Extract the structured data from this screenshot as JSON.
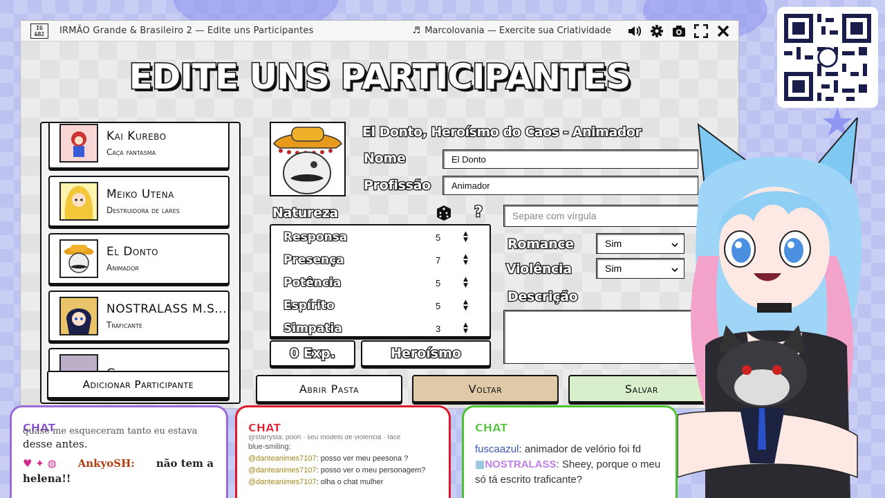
{
  "window": {
    "logo_top": "IG",
    "logo_bottom": "&B2",
    "title": "IRMÃO Grande & Brasileiro 2 — Edite uns Participantes",
    "music_icon": "♬",
    "music": "Marcolovania — Exercite sua Criatividade",
    "icons": [
      "volume-icon",
      "gear-icon",
      "camera-icon",
      "fullscreen-icon",
      "close-icon"
    ]
  },
  "page_title": "EDITE UNS PARTICIPANTES",
  "participants": [
    {
      "name": "Kai Kurebo",
      "role": "Caça fantasma"
    },
    {
      "name": "Meiko Utena",
      "role": "Destruidora de lares"
    },
    {
      "name": "El Donto",
      "role": "Animador"
    },
    {
      "name": "NOSTRALASS M.S...",
      "role": "Traficante"
    },
    {
      "name": "Guaxinico",
      "role": ""
    }
  ],
  "add_participant": "Adicionar Participante",
  "editor": {
    "heading": "El Donto, Heroísmo do Caos - Animador",
    "name_label": "Nome",
    "name_value": "El Donto",
    "profession_label": "Profissão",
    "profession_value": "Animador",
    "nature_label": "Natureza",
    "dice_icon": "dice-icon",
    "help": "?",
    "tags_placeholder": "Separe com vírgula",
    "stats": [
      {
        "name": "Responsa",
        "value": "5"
      },
      {
        "name": "Presença",
        "value": "7"
      },
      {
        "name": "Potência",
        "value": "5"
      },
      {
        "name": "Espírito",
        "value": "5"
      },
      {
        "name": "Simpatia",
        "value": "3"
      }
    ],
    "romance_label": "Romance",
    "romance_value": "Sim",
    "violence_label": "Violência",
    "violence_value": "Sim",
    "description_label": "Descrição",
    "exp": "0 Exp.",
    "trait": "Heroísmo",
    "open_folder": "Abrir Pasta",
    "back": "Voltar",
    "save": "Salvar"
  },
  "chats": {
    "left": {
      "title": "CHAT",
      "color": "#7b3fd0",
      "top_fragment": "quase me esqueceram tanto eu estava",
      "line1": "desse antes.",
      "user": "AnkyoSH:",
      "msg": "não tem a",
      "msg2": "helena!!"
    },
    "middle": {
      "title": "CHAT",
      "color": "#e0182a",
      "top_fragment": "@starrysta: pooh · seu modelo de violência · face",
      "line0": "blue-smiling:",
      "messages": [
        {
          "user": "@danteanimes7107",
          "text": "posso ver meu peesona ?"
        },
        {
          "user": "@danteanimes7107",
          "text": "posso ver o meu personagem?"
        },
        {
          "user": "@danteanimes7107",
          "text": "olha o chat mulher"
        }
      ]
    },
    "right": {
      "title": "CHAT",
      "color": "#4cc232",
      "messages": [
        {
          "user": "fuscaazul",
          "text": "animador de velório foi fd"
        },
        {
          "user": "NOSTRALASS",
          "text": "Sheey, porque o meu"
        },
        {
          "user": "",
          "text": "só tá escrito traficante?"
        }
      ]
    }
  }
}
